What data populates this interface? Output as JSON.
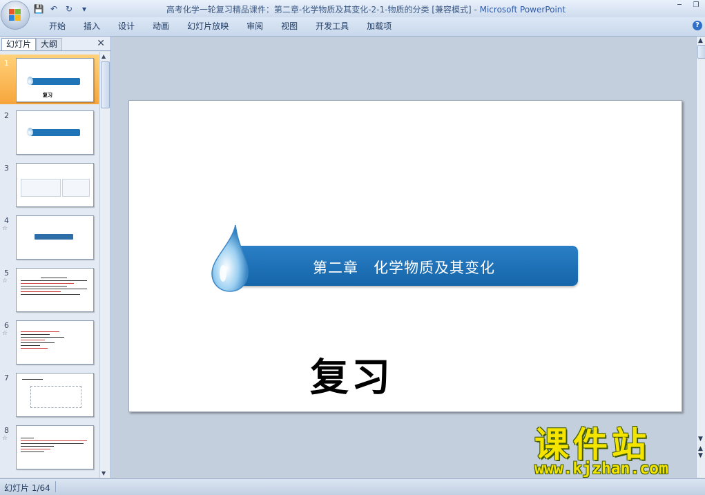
{
  "window": {
    "title": "高考化学一轮复习精品课件：第二章-化学物质及其变化-2-1-物质的分类 [兼容模式] - ",
    "app_name": "Microsoft PowerPoint"
  },
  "quick_access": {
    "icons": [
      "save-icon",
      "undo-icon",
      "redo-icon",
      "customize-icon"
    ]
  },
  "ribbon": {
    "tabs": [
      "开始",
      "插入",
      "设计",
      "动画",
      "幻灯片放映",
      "审阅",
      "视图",
      "开发工具",
      "加载项"
    ],
    "help": "?"
  },
  "panel": {
    "tab_slides": "幻灯片",
    "tab_outline": "大纲",
    "close": "✕",
    "slides": [
      {
        "num": "1",
        "star": "",
        "caption": "复习"
      },
      {
        "num": "2",
        "star": ""
      },
      {
        "num": "3",
        "star": ""
      },
      {
        "num": "4",
        "star": "☆"
      },
      {
        "num": "5",
        "star": "☆"
      },
      {
        "num": "6",
        "star": "☆"
      },
      {
        "num": "7",
        "star": ""
      },
      {
        "num": "8",
        "star": "☆"
      }
    ]
  },
  "slide": {
    "banner_title": "第二章　化学物质及其变化",
    "subtitle": "复习"
  },
  "status": {
    "text": "幻灯片 1/64"
  },
  "watermark": {
    "title": "课件站",
    "url": "www.kjzhan.com"
  }
}
